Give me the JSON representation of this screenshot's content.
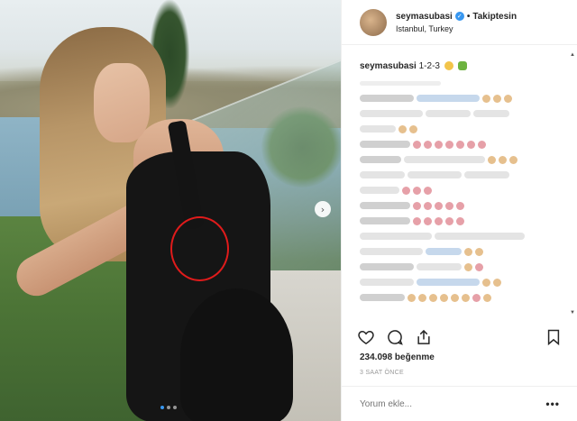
{
  "post": {
    "carousel_dots": 3,
    "active_dot": 1
  },
  "header": {
    "username": "seymasubasi",
    "separator": "•",
    "follow_label": "Takiptesin",
    "location": "Istanbul, Turkey"
  },
  "caption": {
    "username": "seymasubasi",
    "text": "1-2-3"
  },
  "actions": {
    "like_icon": "heart-icon",
    "comment_icon": "comment-icon",
    "share_icon": "share-icon",
    "save_icon": "bookmark-icon"
  },
  "stats": {
    "likes": "234.098 beğenme",
    "time_ago": "3 SAAT ÖNCE"
  },
  "comment_box": {
    "placeholder": "Yorum ekle...",
    "more_label": "•••"
  },
  "colors": {
    "accent": "#3897f0",
    "highlight_circle": "#e01b1b"
  }
}
